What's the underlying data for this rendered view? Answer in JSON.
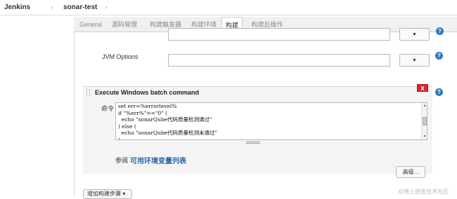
{
  "breadcrumb": {
    "root": "Jenkins",
    "project": "sonar-test"
  },
  "tabs": [
    {
      "label": "General",
      "active": false
    },
    {
      "label": "源码管理",
      "active": false
    },
    {
      "label": "构建触发器",
      "active": false
    },
    {
      "label": "构建环境",
      "active": false
    },
    {
      "label": "构建",
      "active": true
    },
    {
      "label": "构建后操作",
      "active": false
    }
  ],
  "fields": {
    "jvm_options_label": "JVM Options",
    "dropdown_glyph": "▼",
    "help_glyph": "?"
  },
  "step": {
    "title": "Execute Windows batch command",
    "delete_label": "X",
    "command_label": "命令",
    "command_lines": [
      "set err=%errorlevel%",
      "if \"%err%\"==\"0\" (",
      "  echo \"sonarQube代码质量检测通过\"",
      ") else (",
      "  echo \"sonarQube代码质量检测未通过\"",
      ")"
    ],
    "see_label": "参阅",
    "env_link": "可用环境变量列表",
    "advanced_button": "高级..."
  },
  "add_step_button": "增加构建步骤 ▾",
  "watermark": "@稀土掘金技术社区",
  "colors": {
    "help": "#2c7bbf",
    "delete": "#d42a2a",
    "link": "#2868a8"
  }
}
